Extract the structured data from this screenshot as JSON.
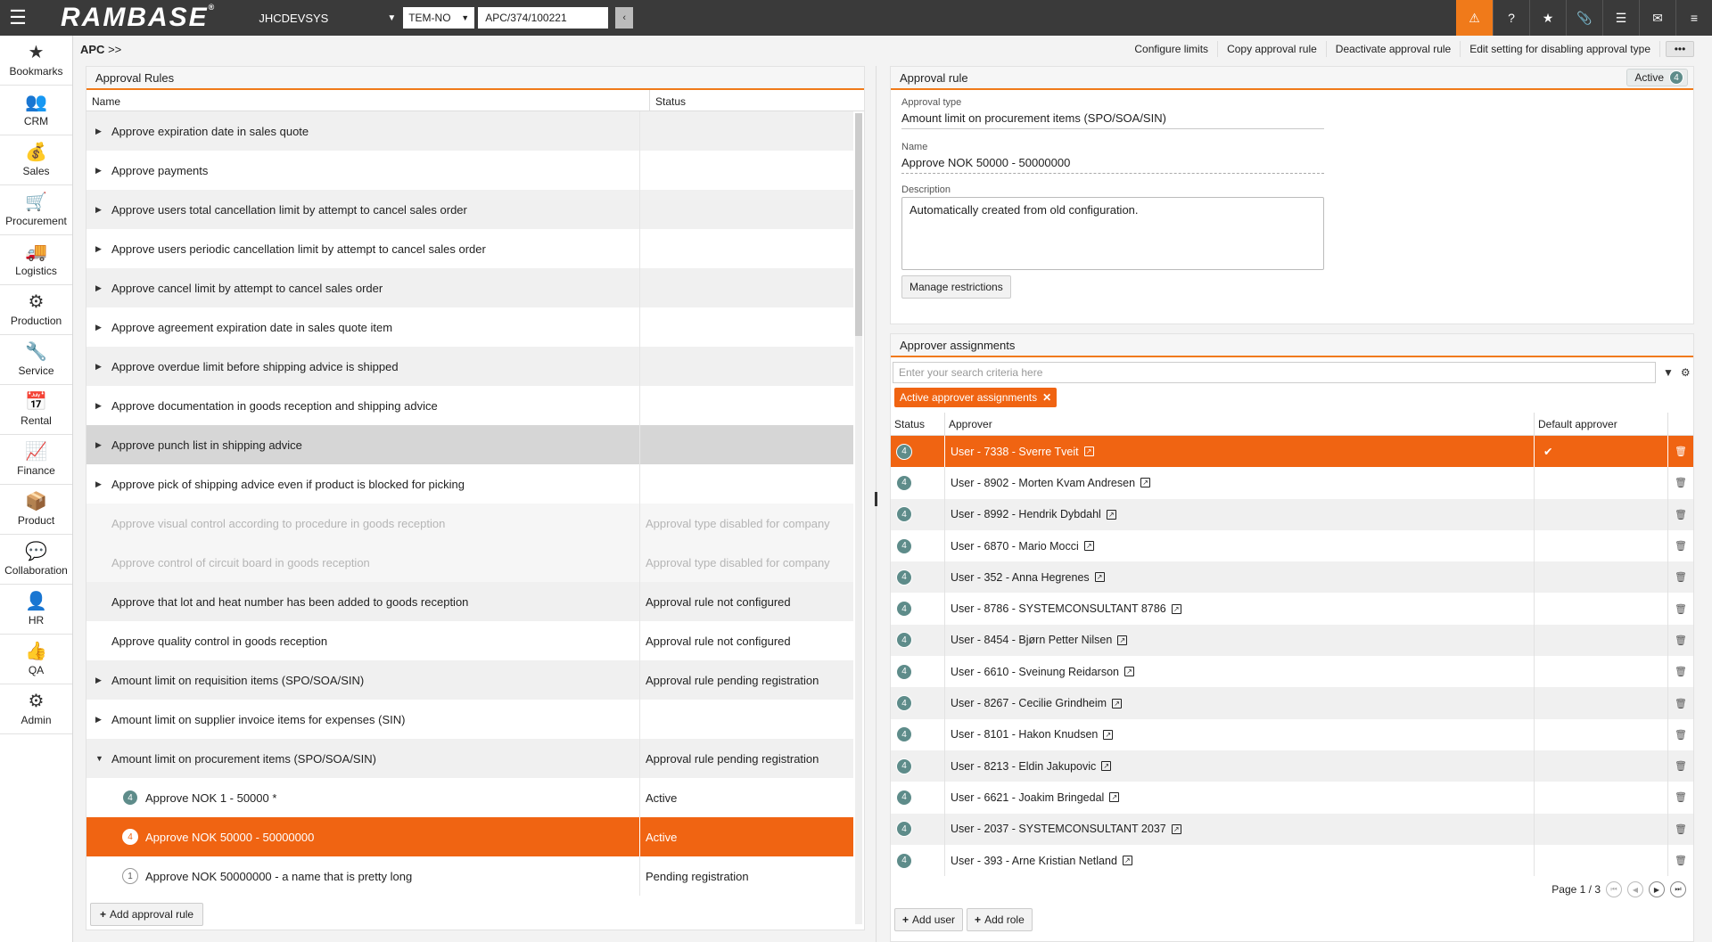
{
  "topbar": {
    "logo": "RAMBASE",
    "logo_mark": "®",
    "system": "JHCDEVSYS",
    "company": "TEM-NO",
    "context_value": "APC/374/100221"
  },
  "nav": [
    {
      "label": "Bookmarks",
      "icon": "★"
    },
    {
      "label": "CRM",
      "icon": "👥"
    },
    {
      "label": "Sales",
      "icon": "💰"
    },
    {
      "label": "Procurement",
      "icon": "🛒"
    },
    {
      "label": "Logistics",
      "icon": "🚚"
    },
    {
      "label": "Production",
      "icon": "⚙"
    },
    {
      "label": "Service",
      "icon": "🔧"
    },
    {
      "label": "Rental",
      "icon": "📅"
    },
    {
      "label": "Finance",
      "icon": "📈"
    },
    {
      "label": "Product",
      "icon": "📦"
    },
    {
      "label": "Collaboration",
      "icon": "💬"
    },
    {
      "label": "HR",
      "icon": "👤"
    },
    {
      "label": "QA",
      "icon": "👍"
    },
    {
      "label": "Admin",
      "icon": "⚙"
    }
  ],
  "breadcrumb": {
    "root": "APC",
    "sep": ">>"
  },
  "actions": {
    "configure_limits": "Configure limits",
    "copy_rule": "Copy approval rule",
    "deactivate_rule": "Deactivate approval rule",
    "edit_setting": "Edit setting for disabling approval type",
    "more": "•••"
  },
  "rules_panel": {
    "title": "Approval Rules",
    "col_name": "Name",
    "col_status": "Status",
    "add_button": "Add approval rule",
    "rows": [
      {
        "name": "Approve expiration date in sales quote",
        "status": "",
        "kind": "parent"
      },
      {
        "name": "Approve payments",
        "status": "",
        "kind": "parent"
      },
      {
        "name": "Approve users total cancellation limit by attempt to cancel sales order",
        "status": "",
        "kind": "parent"
      },
      {
        "name": "Approve users periodic cancellation limit by attempt to cancel sales order",
        "status": "",
        "kind": "parent"
      },
      {
        "name": "Approve cancel limit by attempt to cancel sales order",
        "status": "",
        "kind": "parent"
      },
      {
        "name": "Approve agreement expiration date in sales quote item",
        "status": "",
        "kind": "parent"
      },
      {
        "name": "Approve overdue limit before shipping advice is shipped",
        "status": "",
        "kind": "parent"
      },
      {
        "name": "Approve documentation in goods reception and shipping advice",
        "status": "",
        "kind": "parent"
      },
      {
        "name": "Approve punch list in shipping advice",
        "status": "",
        "kind": "parent",
        "state": "hover"
      },
      {
        "name": "Approve pick of shipping advice even if product is blocked for picking",
        "status": "",
        "kind": "parent"
      },
      {
        "name": "Approve visual control according to procedure in goods reception",
        "status": "Approval type disabled for company",
        "kind": "leaf",
        "state": "disabled"
      },
      {
        "name": "Approve control of circuit board in goods reception",
        "status": "Approval type disabled for company",
        "kind": "leaf",
        "state": "disabled"
      },
      {
        "name": "Approve that lot and heat number has been added to goods reception",
        "status": "Approval rule not configured",
        "kind": "leaf"
      },
      {
        "name": "Approve quality control in goods reception",
        "status": "Approval rule not configured",
        "kind": "leaf"
      },
      {
        "name": "Amount limit on requisition items (SPO/SOA/SIN)",
        "status": "Approval rule pending registration",
        "kind": "parent"
      },
      {
        "name": "Amount limit on supplier invoice items for expenses (SIN)",
        "status": "",
        "kind": "parent"
      },
      {
        "name": "Amount limit on procurement items (SPO/SOA/SIN)",
        "status": "Approval rule pending registration",
        "kind": "expanded"
      },
      {
        "name": "Approve NOK 1 - 50000 *",
        "status": "Active",
        "kind": "child",
        "badge": "4"
      },
      {
        "name": "Approve NOK 50000 - 50000000",
        "status": "Active",
        "kind": "child",
        "badge": "4",
        "state": "selected"
      },
      {
        "name": "Approve NOK 50000000 - a name that is pretty long",
        "status": "Pending registration",
        "kind": "child",
        "badge": "1",
        "badge_style": "outline"
      }
    ]
  },
  "rule_detail": {
    "title": "Approval rule",
    "status_label": "Active",
    "status_badge": "4",
    "type_label": "Approval type",
    "type_value": "Amount limit on procurement items (SPO/SOA/SIN)",
    "name_label": "Name",
    "name_value": "Approve NOK 50000 - 50000000",
    "desc_label": "Description",
    "desc_value": "Automatically created from old configuration.",
    "manage_button": "Manage restrictions"
  },
  "assignments": {
    "title": "Approver assignments",
    "search_placeholder": "Enter your search criteria here",
    "chip": "Active approver assignments",
    "col_status": "Status",
    "col_approver": "Approver",
    "col_default": "Default approver",
    "rows": [
      {
        "badge": "4",
        "approver": "User - 7338 - Sverre Tveit",
        "default": true,
        "selected": true
      },
      {
        "badge": "4",
        "approver": "User - 8902 - Morten Kvam Andresen",
        "default": false
      },
      {
        "badge": "4",
        "approver": "User - 8992 - Hendrik Dybdahl",
        "default": false
      },
      {
        "badge": "4",
        "approver": "User - 6870 - Mario Mocci",
        "default": false
      },
      {
        "badge": "4",
        "approver": "User - 352 - Anna Hegrenes",
        "default": false
      },
      {
        "badge": "4",
        "approver": "User - 8786 - SYSTEMCONSULTANT 8786",
        "default": false
      },
      {
        "badge": "4",
        "approver": "User - 8454 - Bjørn Petter Nilsen",
        "default": false
      },
      {
        "badge": "4",
        "approver": "User - 6610 - Sveinung Reidarson",
        "default": false
      },
      {
        "badge": "4",
        "approver": "User - 8267 - Cecilie Grindheim",
        "default": false
      },
      {
        "badge": "4",
        "approver": "User - 8101 - Hakon Knudsen",
        "default": false
      },
      {
        "badge": "4",
        "approver": "User - 8213 - Eldin Jakupovic",
        "default": false
      },
      {
        "badge": "4",
        "approver": "User - 6621 - Joakim Bringedal",
        "default": false
      },
      {
        "badge": "4",
        "approver": "User - 2037 - SYSTEMCONSULTANT 2037",
        "default": false
      },
      {
        "badge": "4",
        "approver": "User - 393 - Arne Kristian Netland",
        "default": false
      }
    ],
    "pager": "Page 1 / 3",
    "add_user": "Add user",
    "add_role": "Add role"
  }
}
